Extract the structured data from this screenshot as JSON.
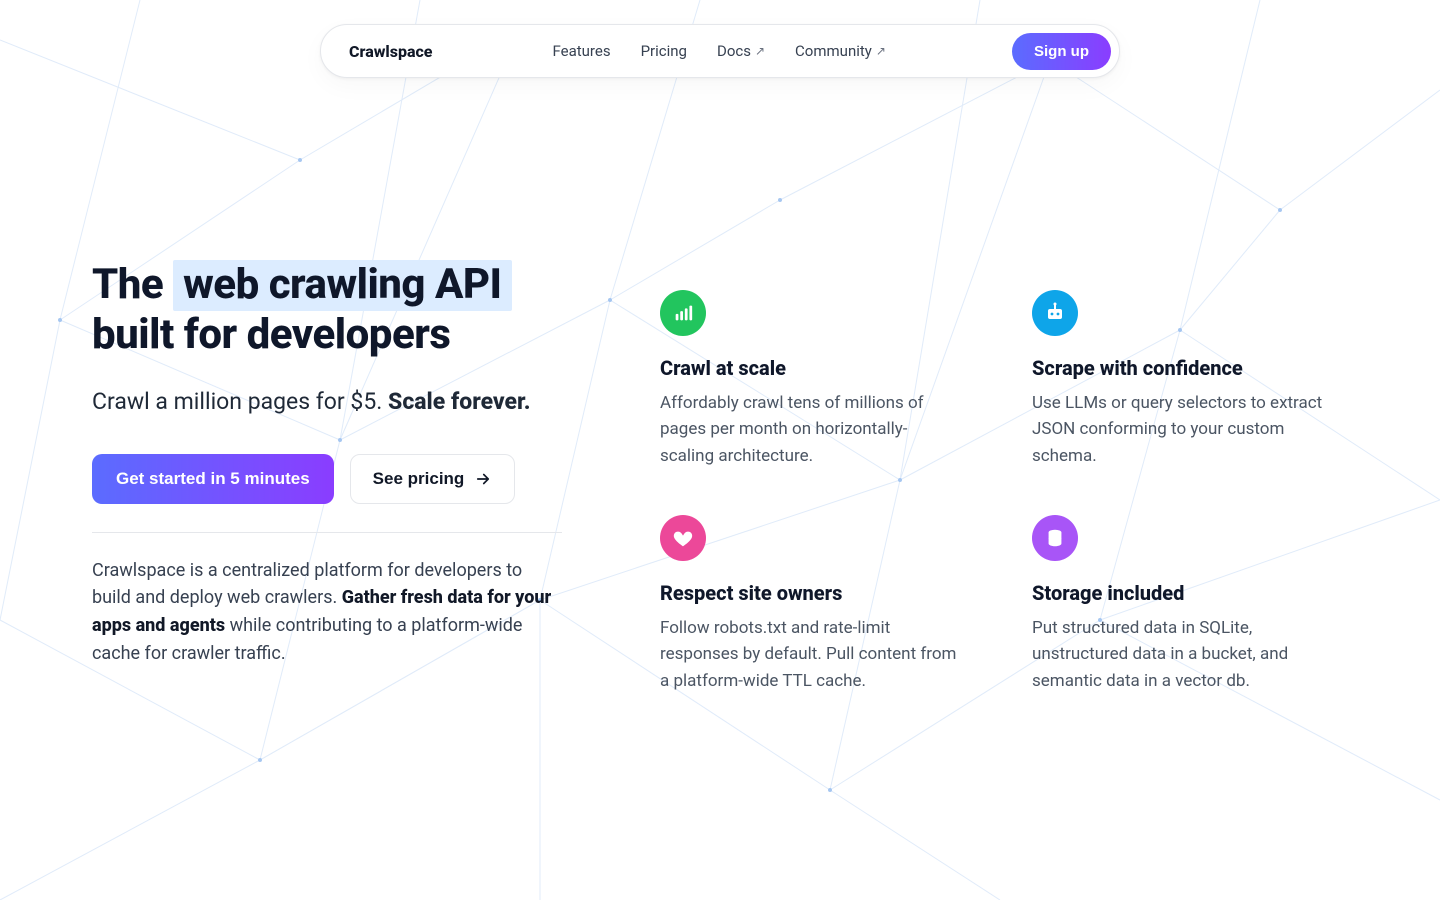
{
  "nav": {
    "brand": "Crawlspace",
    "links": [
      {
        "label": "Features",
        "external": false
      },
      {
        "label": "Pricing",
        "external": false
      },
      {
        "label": "Docs",
        "external": true
      },
      {
        "label": "Community",
        "external": true
      }
    ],
    "signup": "Sign up"
  },
  "hero": {
    "title_prefix": "The",
    "title_highlight": "web crawling API",
    "title_suffix": "built for developers",
    "sub_plain": "Crawl a million pages for $5. ",
    "sub_bold": "Scale forever.",
    "cta_primary": "Get started in 5 minutes",
    "cta_secondary": "See pricing",
    "blurb_a": "Crawlspace is a centralized platform for developers to build and deploy web crawlers. ",
    "blurb_bold": "Gather fresh data for your apps and agents",
    "blurb_b": " while contributing to a platform-wide cache for crawler traffic."
  },
  "features": [
    {
      "icon": "bars-icon",
      "color": "green",
      "title": "Crawl at scale",
      "body": "Affordably crawl tens of millions of pages per month on horizontally-scaling architecture."
    },
    {
      "icon": "robot-icon",
      "color": "blue",
      "title": "Scrape with confidence",
      "body": "Use LLMs or query selectors to extract JSON conforming to your custom schema."
    },
    {
      "icon": "heart-icon",
      "color": "pink",
      "title": "Respect site owners",
      "body": "Follow robots.txt and rate-limit responses by default. Pull content from a platform-wide TTL cache."
    },
    {
      "icon": "database-icon",
      "color": "purple",
      "title": "Storage included",
      "body": "Put structured data in SQLite, unstructured data in a bucket, and semantic data in a vector db."
    }
  ]
}
